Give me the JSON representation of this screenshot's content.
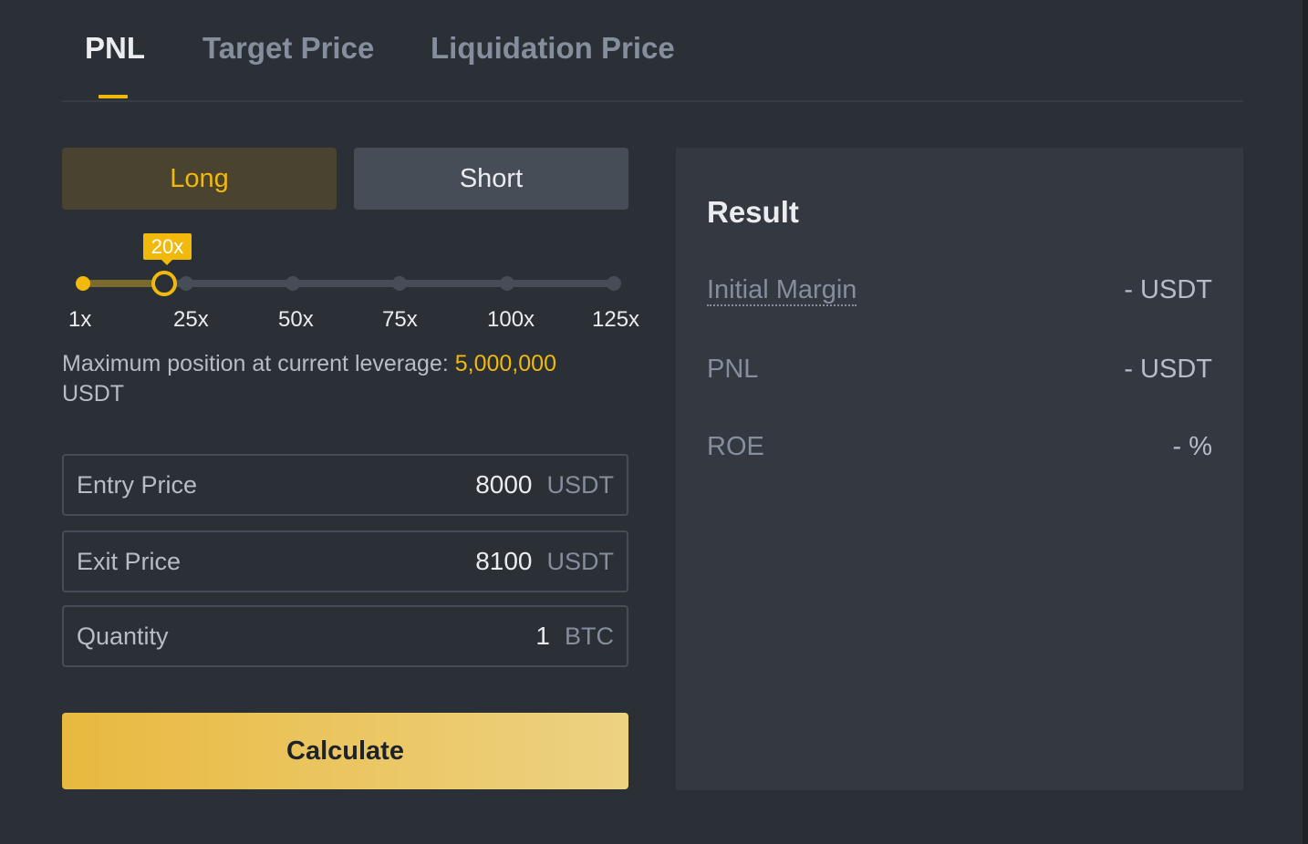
{
  "tabs": [
    {
      "label": "PNL",
      "active": true
    },
    {
      "label": "Target Price",
      "active": false
    },
    {
      "label": "Liquidation Price",
      "active": false
    }
  ],
  "side": {
    "long_label": "Long",
    "short_label": "Short",
    "selected": "Long"
  },
  "leverage": {
    "current_label": "20x",
    "current_value": 20,
    "min": 1,
    "max": 125,
    "ticks": [
      "1x",
      "25x",
      "50x",
      "75x",
      "100x",
      "125x"
    ]
  },
  "max_position": {
    "prefix": "Maximum position at current leverage:",
    "amount": "5,000,000",
    "unit": "USDT"
  },
  "fields": {
    "entry": {
      "label": "Entry Price",
      "value": "8000",
      "unit": "USDT"
    },
    "exit": {
      "label": "Exit Price",
      "value": "8100",
      "unit": "USDT"
    },
    "quantity": {
      "label": "Quantity",
      "value": "1",
      "unit": "BTC"
    }
  },
  "calculate_label": "Calculate",
  "result": {
    "title": "Result",
    "rows": [
      {
        "label": "Initial Margin",
        "value": "- USDT"
      },
      {
        "label": "PNL",
        "value": "- USDT"
      },
      {
        "label": "ROE",
        "value": "- %"
      }
    ]
  },
  "colors": {
    "accent": "#f0b90b",
    "background": "#2b2f36",
    "panel": "#343841"
  }
}
